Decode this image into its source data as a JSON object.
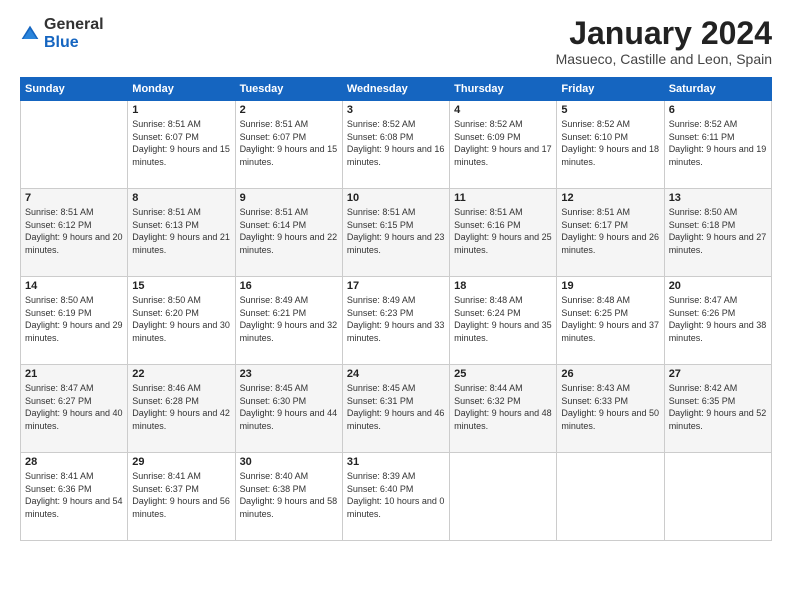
{
  "logo": {
    "general": "General",
    "blue": "Blue"
  },
  "header": {
    "title": "January 2024",
    "location": "Masueco, Castille and Leon, Spain"
  },
  "weekdays": [
    "Sunday",
    "Monday",
    "Tuesday",
    "Wednesday",
    "Thursday",
    "Friday",
    "Saturday"
  ],
  "weeks": [
    [
      {
        "day": "",
        "sunrise": "",
        "sunset": "",
        "daylight": ""
      },
      {
        "day": "1",
        "sunrise": "Sunrise: 8:51 AM",
        "sunset": "Sunset: 6:07 PM",
        "daylight": "Daylight: 9 hours and 15 minutes."
      },
      {
        "day": "2",
        "sunrise": "Sunrise: 8:51 AM",
        "sunset": "Sunset: 6:07 PM",
        "daylight": "Daylight: 9 hours and 15 minutes."
      },
      {
        "day": "3",
        "sunrise": "Sunrise: 8:52 AM",
        "sunset": "Sunset: 6:08 PM",
        "daylight": "Daylight: 9 hours and 16 minutes."
      },
      {
        "day": "4",
        "sunrise": "Sunrise: 8:52 AM",
        "sunset": "Sunset: 6:09 PM",
        "daylight": "Daylight: 9 hours and 17 minutes."
      },
      {
        "day": "5",
        "sunrise": "Sunrise: 8:52 AM",
        "sunset": "Sunset: 6:10 PM",
        "daylight": "Daylight: 9 hours and 18 minutes."
      },
      {
        "day": "6",
        "sunrise": "Sunrise: 8:52 AM",
        "sunset": "Sunset: 6:11 PM",
        "daylight": "Daylight: 9 hours and 19 minutes."
      }
    ],
    [
      {
        "day": "7",
        "sunrise": "Sunrise: 8:51 AM",
        "sunset": "Sunset: 6:12 PM",
        "daylight": "Daylight: 9 hours and 20 minutes."
      },
      {
        "day": "8",
        "sunrise": "Sunrise: 8:51 AM",
        "sunset": "Sunset: 6:13 PM",
        "daylight": "Daylight: 9 hours and 21 minutes."
      },
      {
        "day": "9",
        "sunrise": "Sunrise: 8:51 AM",
        "sunset": "Sunset: 6:14 PM",
        "daylight": "Daylight: 9 hours and 22 minutes."
      },
      {
        "day": "10",
        "sunrise": "Sunrise: 8:51 AM",
        "sunset": "Sunset: 6:15 PM",
        "daylight": "Daylight: 9 hours and 23 minutes."
      },
      {
        "day": "11",
        "sunrise": "Sunrise: 8:51 AM",
        "sunset": "Sunset: 6:16 PM",
        "daylight": "Daylight: 9 hours and 25 minutes."
      },
      {
        "day": "12",
        "sunrise": "Sunrise: 8:51 AM",
        "sunset": "Sunset: 6:17 PM",
        "daylight": "Daylight: 9 hours and 26 minutes."
      },
      {
        "day": "13",
        "sunrise": "Sunrise: 8:50 AM",
        "sunset": "Sunset: 6:18 PM",
        "daylight": "Daylight: 9 hours and 27 minutes."
      }
    ],
    [
      {
        "day": "14",
        "sunrise": "Sunrise: 8:50 AM",
        "sunset": "Sunset: 6:19 PM",
        "daylight": "Daylight: 9 hours and 29 minutes."
      },
      {
        "day": "15",
        "sunrise": "Sunrise: 8:50 AM",
        "sunset": "Sunset: 6:20 PM",
        "daylight": "Daylight: 9 hours and 30 minutes."
      },
      {
        "day": "16",
        "sunrise": "Sunrise: 8:49 AM",
        "sunset": "Sunset: 6:21 PM",
        "daylight": "Daylight: 9 hours and 32 minutes."
      },
      {
        "day": "17",
        "sunrise": "Sunrise: 8:49 AM",
        "sunset": "Sunset: 6:23 PM",
        "daylight": "Daylight: 9 hours and 33 minutes."
      },
      {
        "day": "18",
        "sunrise": "Sunrise: 8:48 AM",
        "sunset": "Sunset: 6:24 PM",
        "daylight": "Daylight: 9 hours and 35 minutes."
      },
      {
        "day": "19",
        "sunrise": "Sunrise: 8:48 AM",
        "sunset": "Sunset: 6:25 PM",
        "daylight": "Daylight: 9 hours and 37 minutes."
      },
      {
        "day": "20",
        "sunrise": "Sunrise: 8:47 AM",
        "sunset": "Sunset: 6:26 PM",
        "daylight": "Daylight: 9 hours and 38 minutes."
      }
    ],
    [
      {
        "day": "21",
        "sunrise": "Sunrise: 8:47 AM",
        "sunset": "Sunset: 6:27 PM",
        "daylight": "Daylight: 9 hours and 40 minutes."
      },
      {
        "day": "22",
        "sunrise": "Sunrise: 8:46 AM",
        "sunset": "Sunset: 6:28 PM",
        "daylight": "Daylight: 9 hours and 42 minutes."
      },
      {
        "day": "23",
        "sunrise": "Sunrise: 8:45 AM",
        "sunset": "Sunset: 6:30 PM",
        "daylight": "Daylight: 9 hours and 44 minutes."
      },
      {
        "day": "24",
        "sunrise": "Sunrise: 8:45 AM",
        "sunset": "Sunset: 6:31 PM",
        "daylight": "Daylight: 9 hours and 46 minutes."
      },
      {
        "day": "25",
        "sunrise": "Sunrise: 8:44 AM",
        "sunset": "Sunset: 6:32 PM",
        "daylight": "Daylight: 9 hours and 48 minutes."
      },
      {
        "day": "26",
        "sunrise": "Sunrise: 8:43 AM",
        "sunset": "Sunset: 6:33 PM",
        "daylight": "Daylight: 9 hours and 50 minutes."
      },
      {
        "day": "27",
        "sunrise": "Sunrise: 8:42 AM",
        "sunset": "Sunset: 6:35 PM",
        "daylight": "Daylight: 9 hours and 52 minutes."
      }
    ],
    [
      {
        "day": "28",
        "sunrise": "Sunrise: 8:41 AM",
        "sunset": "Sunset: 6:36 PM",
        "daylight": "Daylight: 9 hours and 54 minutes."
      },
      {
        "day": "29",
        "sunrise": "Sunrise: 8:41 AM",
        "sunset": "Sunset: 6:37 PM",
        "daylight": "Daylight: 9 hours and 56 minutes."
      },
      {
        "day": "30",
        "sunrise": "Sunrise: 8:40 AM",
        "sunset": "Sunset: 6:38 PM",
        "daylight": "Daylight: 9 hours and 58 minutes."
      },
      {
        "day": "31",
        "sunrise": "Sunrise: 8:39 AM",
        "sunset": "Sunset: 6:40 PM",
        "daylight": "Daylight: 10 hours and 0 minutes."
      },
      {
        "day": "",
        "sunrise": "",
        "sunset": "",
        "daylight": ""
      },
      {
        "day": "",
        "sunrise": "",
        "sunset": "",
        "daylight": ""
      },
      {
        "day": "",
        "sunrise": "",
        "sunset": "",
        "daylight": ""
      }
    ]
  ]
}
